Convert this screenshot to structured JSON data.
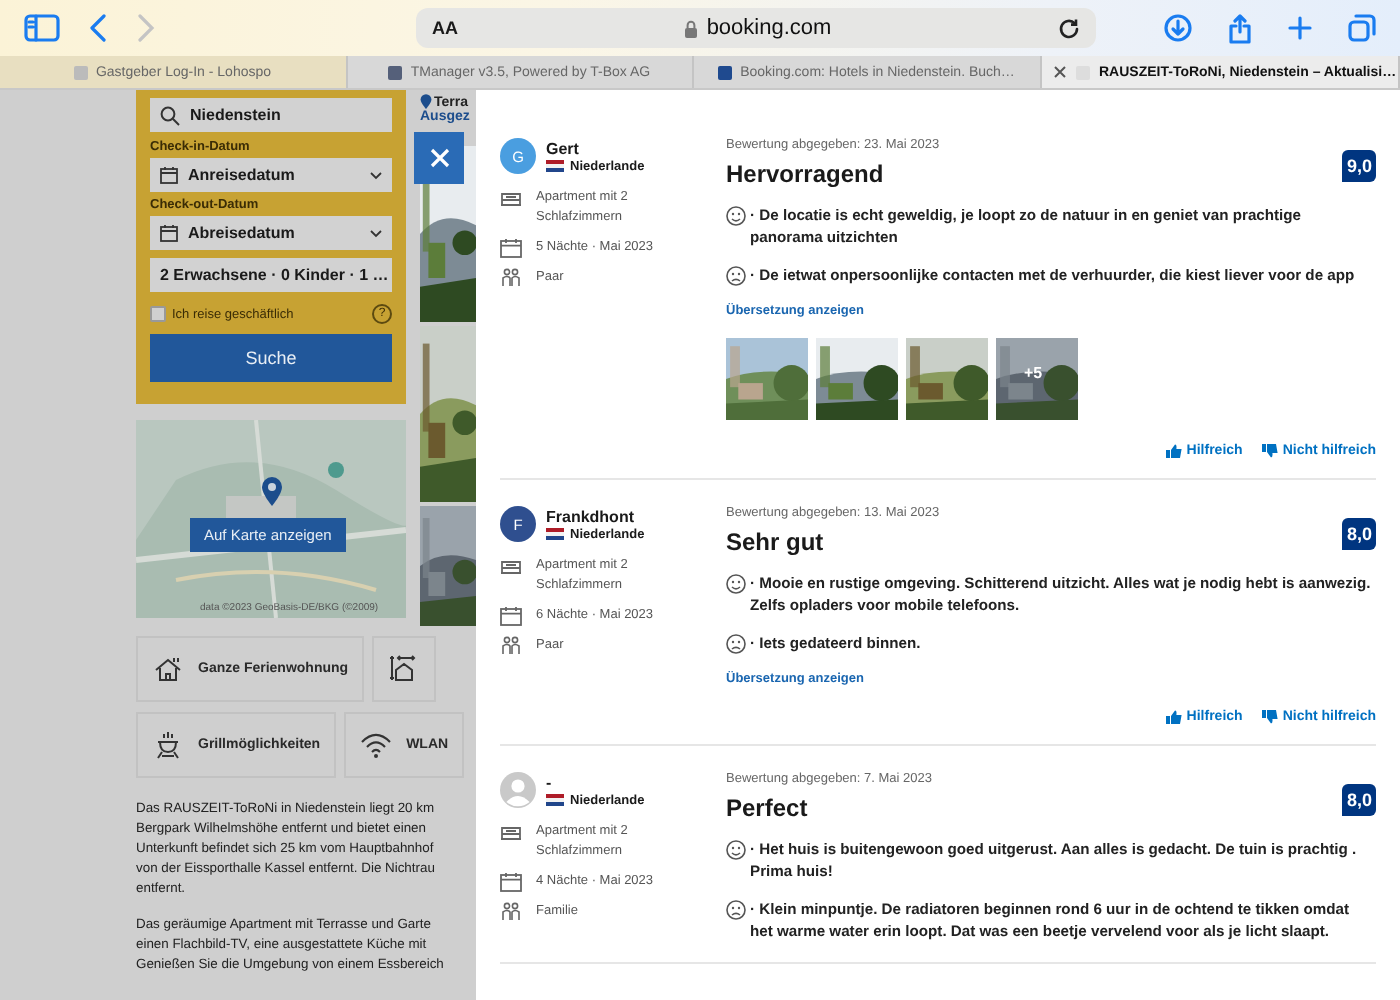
{
  "browser": {
    "address": "booking.com",
    "text_size_button": "AA",
    "tabs": [
      {
        "title": "Gastgeber Log-In - Lohospo",
        "selected": false
      },
      {
        "title": "TManager v3.5, Powered by T-Box AG",
        "selected": false
      },
      {
        "title": "Booking.com: Hotels in Niedenstein. Buch…",
        "selected": false
      },
      {
        "title": "RAUSZEIT-ToRoNi, Niedenstein – Aktualisi…",
        "selected": true
      }
    ]
  },
  "search": {
    "destination": "Niedenstein",
    "fields": [
      {
        "label": "Check-in-Datum",
        "value": "Anreisedatum",
        "kind": "date"
      },
      {
        "label": "Check-out-Datum",
        "value": "Abreisedatum",
        "kind": "date"
      },
      {
        "value": "2 Erwachsene · 0 Kinder · 1 …",
        "kind": "guests"
      }
    ],
    "business": {
      "label": "Ich reise geschäftlich",
      "checked": false
    },
    "help": "?",
    "button": "Suche"
  },
  "header_texts": [
    "Terra",
    "Ausgez"
  ],
  "map": {
    "button": "Auf Karte anzeigen",
    "attribution": "data ©2023 GeoBasis-DE/BKG (©2009)"
  },
  "facilities": [
    [
      {
        "kind": "house",
        "label": "Ganze Ferienwohnung"
      },
      {
        "kind": "size"
      }
    ],
    [
      {
        "kind": "grill",
        "label": "Grillmöglichkeiten"
      },
      {
        "kind": "wifi",
        "label": "WLAN"
      }
    ]
  ],
  "description": [
    [
      "Das RAUSZEIT-ToRoNi in Niedenstein liegt 20 km",
      "Bergpark Wilhelmshöhe entfernt und bietet einen",
      "Unterkunft befindet sich 25 km vom Hauptbahnhof",
      "von der Eissporthalle Kassel entfernt. Die Nichtrau",
      "entfernt."
    ],
    [
      "Das geräumige Apartment mit Terrasse und Garte",
      "einen Flachbild-TV, eine ausgestattete Küche mit",
      "Genießen Sie die Umgebung von einem Essbereich"
    ]
  ],
  "reviews": [
    {
      "avatar": {
        "kind": "letter",
        "letter": "G",
        "color": "#4a9ee0"
      },
      "name": "Gert",
      "country": "Niederlande",
      "room": "Apartment mit 2 Schlafzimmern",
      "stay": "5 Nächte · Mai 2023",
      "travelers": "Paar",
      "date": "Bewertung abgegeben: 23. Mai 2023",
      "title": "Hervorragend",
      "score": "9,0",
      "positive": "· De locatie is echt geweldig, je loopt zo de natuur in en geniet van prachtige panorama uitzichten",
      "negative": "· De ietwat onpersoonlijke contacten met de verhuurder, die kiest liever voor de app",
      "translate": "Übersetzung anzeigen",
      "photos": [
        {
          "kind": "picture"
        },
        {
          "kind": "picture"
        },
        {
          "kind": "picture"
        },
        {
          "kind": "picture",
          "more": "+5"
        }
      ],
      "helpful": "Hilfreich",
      "not_helpful": "Nicht hilfreich"
    },
    {
      "avatar": {
        "kind": "letter",
        "letter": "F",
        "color": "#2f4f8f"
      },
      "name": "Frankdhont",
      "country": "Niederlande",
      "room": "Apartment mit 2 Schlafzimmern",
      "stay": "6 Nächte · Mai 2023",
      "travelers": "Paar",
      "date": "Bewertung abgegeben: 13. Mai 2023",
      "title": "Sehr gut",
      "score": "8,0",
      "positive": "· Mooie en rustige omgeving. Schitterend uitzicht. Alles wat je nodig hebt is aanwezig. Zelfs opladers voor mobile telefoons.",
      "negative": "· Iets gedateerd binnen.",
      "translate": "Übersetzung anzeigen",
      "helpful": "Hilfreich",
      "not_helpful": "Nicht hilfreich"
    },
    {
      "avatar": {
        "kind": "silhouette"
      },
      "name": "-",
      "country": "Niederlande",
      "room": "Apartment mit 2 Schlafzimmern",
      "stay": "4 Nächte · Mai 2023",
      "travelers": "Familie",
      "date": "Bewertung abgegeben: 7. Mai 2023",
      "title": "Perfect",
      "score": "8,0",
      "positive": "· Het huis is buitengewoon goed uitgerust. Aan alles is gedacht. De tuin is prachtig . Prima huis!",
      "negative": "· Klein minpuntje. De radiatoren beginnen rond 6 uur in de ochtend te tikken omdat het warme water erin loopt. Dat was een beetje vervelend voor als je licht slaapt."
    }
  ]
}
